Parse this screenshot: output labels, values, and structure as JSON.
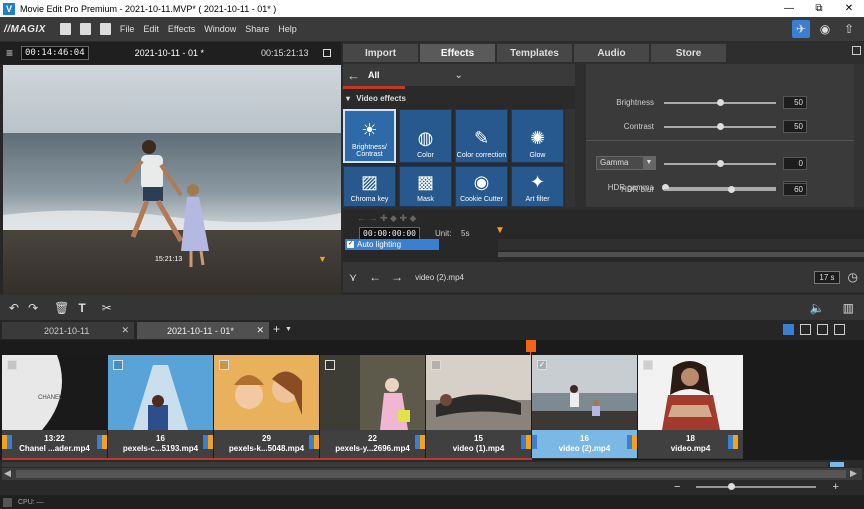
{
  "titlebar": {
    "title": "Movie Edit Pro Premium - 2021-10-11.MVP* ( 2021-10-11 - 01* )",
    "app_letter": "V",
    "min": "—",
    "restore": "⧉",
    "close": "✕"
  },
  "menubar": {
    "logo": "//MAGIX",
    "items": [
      "File",
      "Edit",
      "Effects",
      "Window",
      "Share",
      "Help"
    ]
  },
  "preview": {
    "timecode_left": "00:14:46:04",
    "title": "2021-10-11 - 01 *",
    "timecode_right": "00:15:21:13",
    "position_time": "15:21:13"
  },
  "transport": {
    "buttons": [
      "[",
      "]",
      "[←",
      "|◀",
      "▶",
      "[▷]",
      "→|",
      "●",
      "⚡"
    ]
  },
  "tabs": [
    "Import",
    "Effects",
    "Templates",
    "Audio",
    "Store"
  ],
  "effects": {
    "back_label": "All",
    "section": "Video effects",
    "tiles": [
      "Brightness/ Contrast",
      "Color",
      "Color correction",
      "Glow",
      "Chroma key",
      "Mask",
      "Cookie Cutter",
      "Art filter"
    ]
  },
  "sliders": [
    {
      "label": "Brightness",
      "value": "50",
      "level": 0.5
    },
    {
      "label": "Contrast",
      "value": "50",
      "level": 0.5
    },
    {
      "label": "Gamma",
      "value": "0",
      "level": 0.5
    },
    {
      "label": "HDR gamma",
      "value": "0",
      "level": 0.0
    },
    {
      "label": "HDR blur",
      "value": "60",
      "level": 0.6
    }
  ],
  "gamma_dropdown": "Gamma",
  "keyframes": {
    "time": "00:00:00:00",
    "unit_label": "Unit:",
    "unit_value": "5s",
    "auto_lighting": "Auto lighting"
  },
  "nav": {
    "current_clip": "video (2).mp4",
    "zoom": "17 s"
  },
  "project_tabs": [
    {
      "label": "2021-10-11",
      "active": false
    },
    {
      "label": "2021-10-11 - 01*",
      "active": true
    }
  ],
  "clips": [
    {
      "duration": "13:22",
      "name": "Chanel ...ader.mp4",
      "checked": false,
      "selected": false
    },
    {
      "duration": "16",
      "name": "pexels-c...5193.mp4",
      "checked": false,
      "selected": false
    },
    {
      "duration": "29",
      "name": "pexels-k...5048.mp4",
      "checked": false,
      "selected": false
    },
    {
      "duration": "22",
      "name": "pexels-y...2696.mp4",
      "checked": false,
      "selected": false
    },
    {
      "duration": "15",
      "name": "video (1).mp4",
      "checked": false,
      "selected": false
    },
    {
      "duration": "16",
      "name": "video (2).mp4",
      "checked": true,
      "selected": true
    },
    {
      "duration": "18",
      "name": "video.mp4",
      "checked": false,
      "selected": false
    }
  ],
  "status": {
    "cpu": "CPU: —"
  },
  "colors": {
    "accent": "#3b7fd0",
    "tile": "#27598f",
    "record": "#e03b3b",
    "marker": "#f3a31a"
  }
}
